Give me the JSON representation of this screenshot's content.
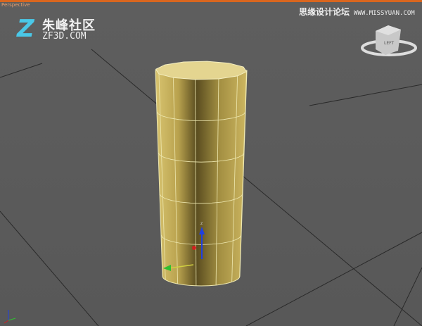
{
  "viewport": {
    "label": "Perspective",
    "accent": "#d9661f"
  },
  "watermark_left": {
    "logo_letter": "Z",
    "chinese": "朱峰社区",
    "english": "ZF3D.COM"
  },
  "watermark_right": {
    "chinese": "思缘设计论坛",
    "english": "WWW.MISSYUAN.COM"
  },
  "viewcube": {
    "face": "LEFT"
  },
  "object": {
    "type": "cylinder",
    "color": "#c9b25a",
    "sides": 12,
    "height_segments": 5
  },
  "gizmo": {
    "x_color": "#30c030",
    "y_color": "#d0d040",
    "z_color": "#2040e0",
    "z_label": "z"
  }
}
